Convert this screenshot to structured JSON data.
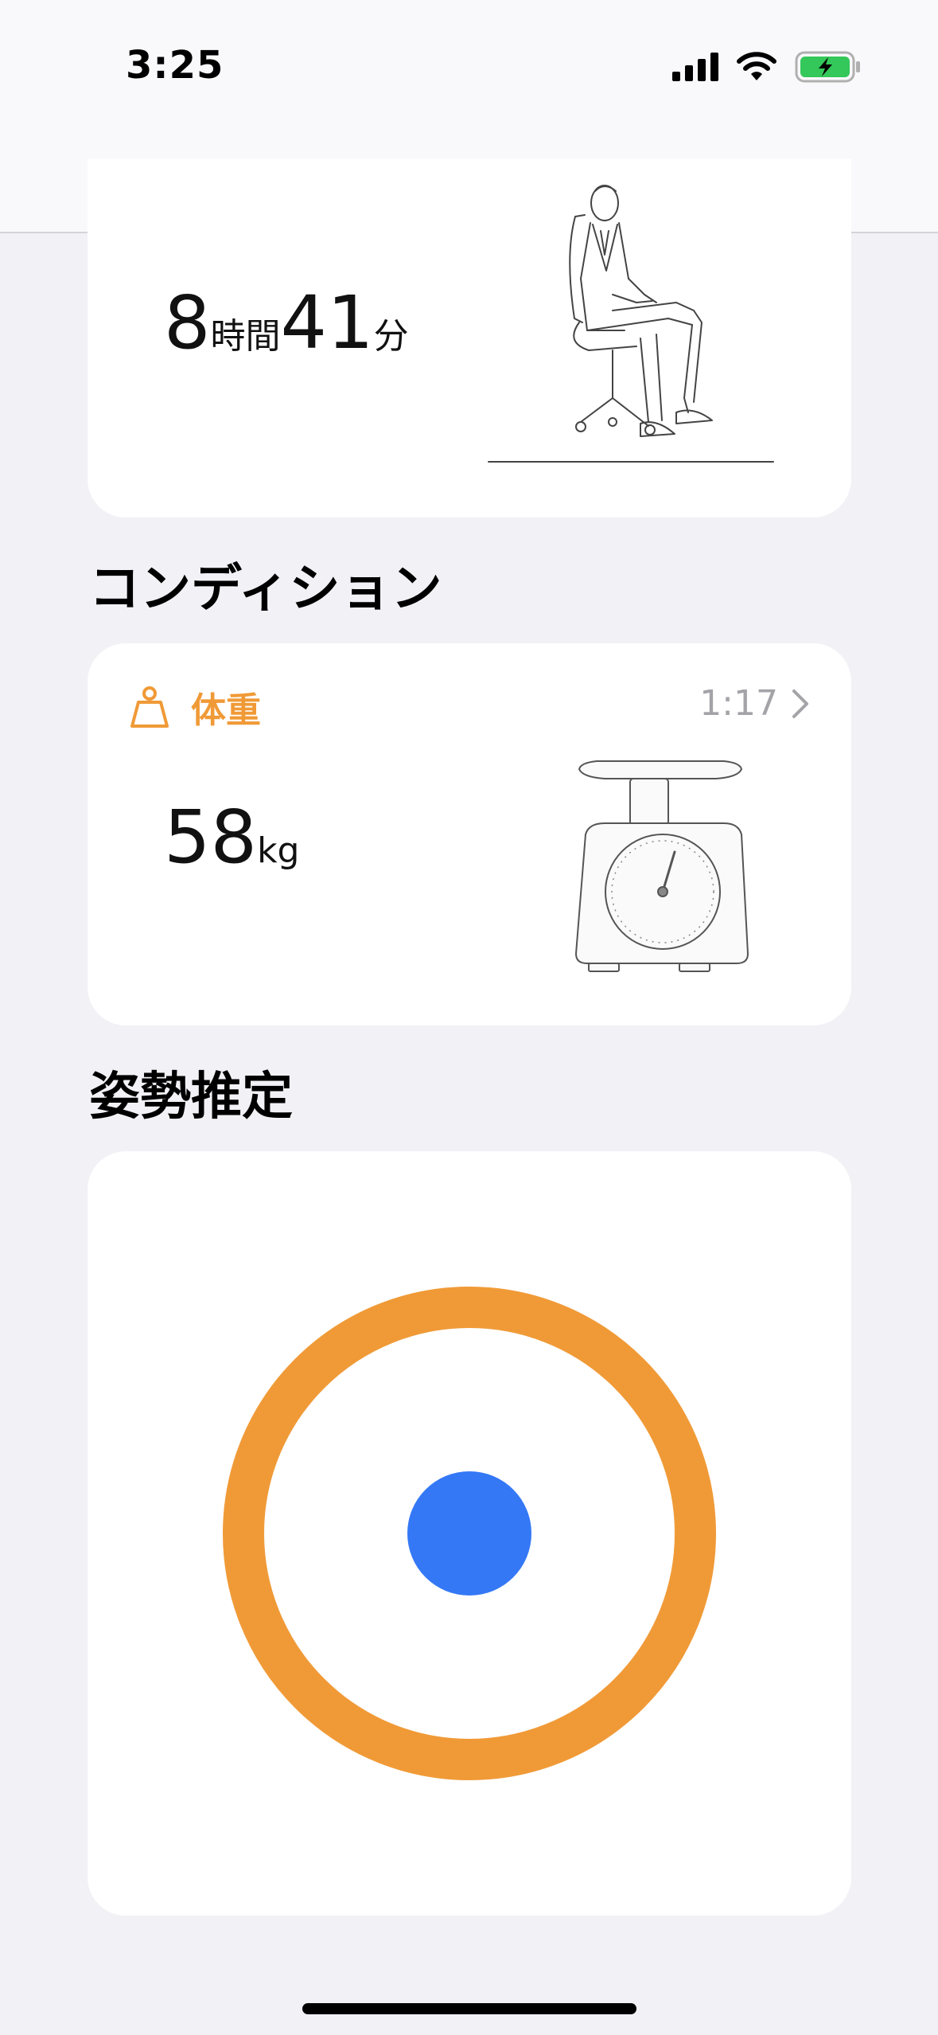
{
  "status_bar": {
    "time": "3:25",
    "signal_icon": "cellular-signal-icon",
    "wifi_icon": "wifi-icon",
    "battery_icon": "battery-charging-icon",
    "battery_color": "#34c759"
  },
  "sleep_card": {
    "hours": "8",
    "hours_unit": "時間",
    "minutes": "41",
    "minutes_unit": "分",
    "illustration": "seated-person-illustration"
  },
  "condition_section": {
    "title": "コンディション"
  },
  "weight_card": {
    "icon": "weight-icon",
    "label": "体重",
    "time": "1:17",
    "chevron": "chevron-right-icon",
    "value": "58",
    "unit": "kg",
    "illustration": "scale-illustration",
    "accent_color": "#f09a37"
  },
  "posture_section": {
    "title": "姿勢推定"
  },
  "posture_card": {
    "ring_color": "#f09a37",
    "dot_color": "#3478f6"
  }
}
